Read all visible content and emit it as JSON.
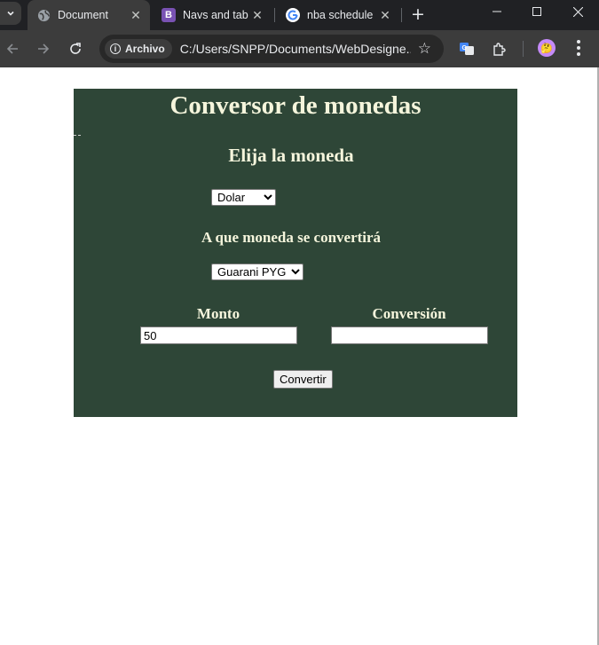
{
  "browser": {
    "tabs": [
      {
        "title": "Document",
        "active": true,
        "favicon": "globe-icon"
      },
      {
        "title": "Navs and tab",
        "active": false,
        "favicon": "bootstrap-icon"
      },
      {
        "title": "nba schedule",
        "active": false,
        "favicon": "google-icon"
      }
    ],
    "address_chip": "Archivo",
    "url": "C:/Users/SNPP/Documents/WebDesigne..."
  },
  "page": {
    "title": "Conversor de monedas",
    "choose_currency_heading": "Elija la moneda",
    "from_currency": {
      "selected": "Dolar"
    },
    "target_heading": "A que moneda se convertirá",
    "to_currency": {
      "selected": "Guarani PYG"
    },
    "amount_label": "Monto",
    "amount_value": "50",
    "conversion_label": "Conversión",
    "conversion_value": "",
    "convert_button": "Convertir"
  },
  "colors": {
    "panel_bg": "#2e4637",
    "panel_text": "#f5f5dc"
  }
}
